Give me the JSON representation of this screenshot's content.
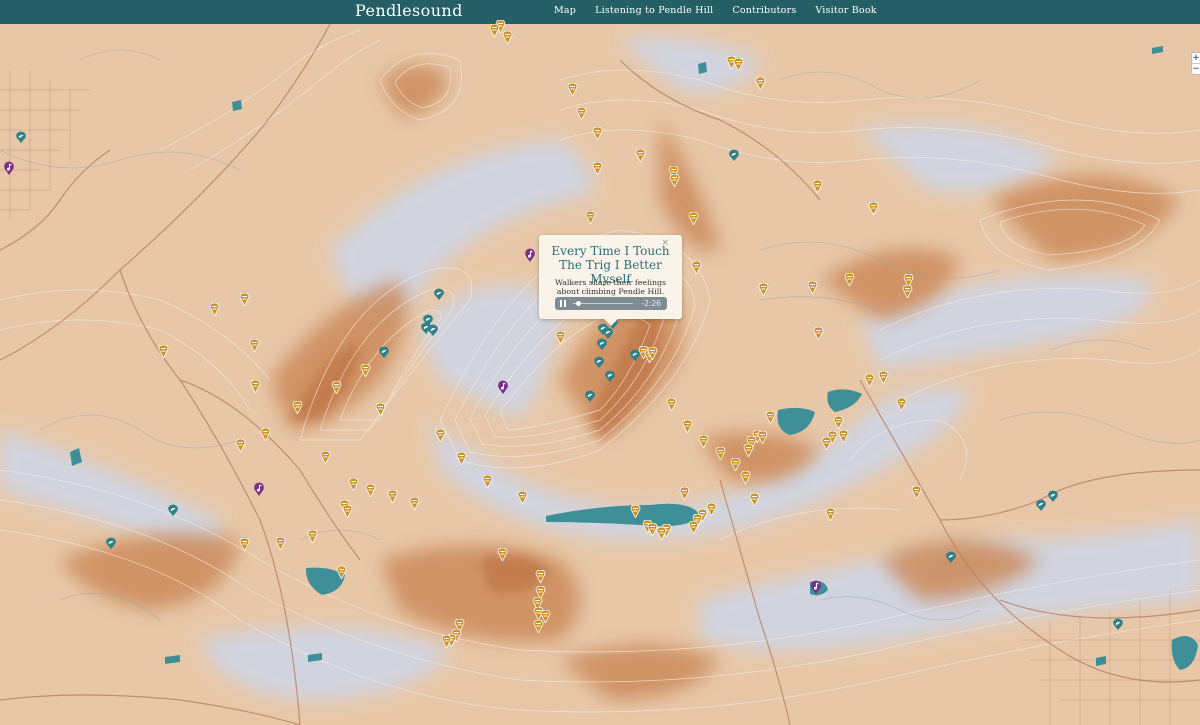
{
  "site": {
    "title": "Pendlesound",
    "nav": [
      "Map",
      "Listening to Pendle Hill",
      "Contributors",
      "Visitor Book"
    ]
  },
  "map": {
    "zoom_in": "+",
    "zoom_out": "−",
    "colors": {
      "terrain": "#e7c7a8",
      "ridge": "#c98757",
      "valley": "#cfd6e6",
      "water": "#3f8f98",
      "contour": "#f7efe6",
      "road": "#b47a5e",
      "marker_gold": "#c9922a",
      "marker_teal": "#2f8088",
      "marker_purple": "#7d2d8c"
    },
    "marker_types": {
      "gold": "hill-sound-marker-icon",
      "teal": "bird-sound-marker-icon",
      "purple": "music-note-marker-icon"
    }
  },
  "popup": {
    "title": "Every Time I Touch The Trig I Better Myself",
    "description": "Walkers share their feelings about climbing Pendle Hill.",
    "time": "-2:26",
    "close": "×"
  }
}
